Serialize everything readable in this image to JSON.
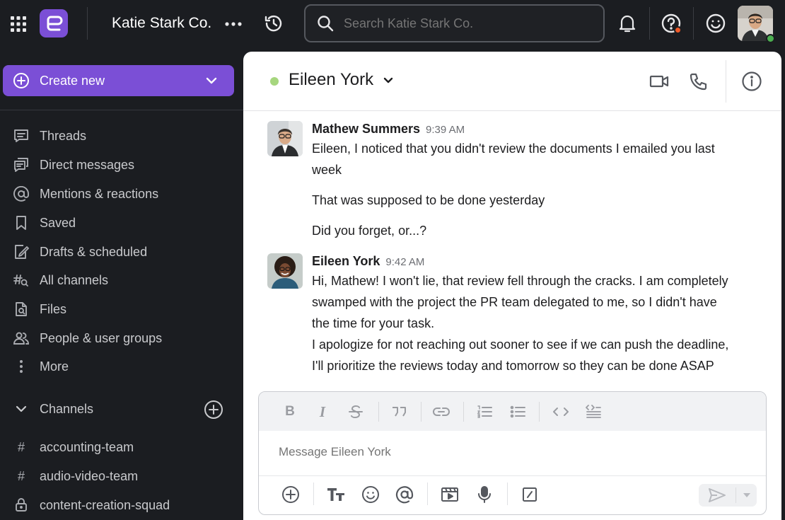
{
  "topbar": {
    "team_name": "Katie Stark Co.",
    "search_placeholder": "Search Katie Stark Co."
  },
  "sidebar": {
    "create_label": "Create new",
    "nav": [
      {
        "label": "Threads",
        "icon": "threads-icon"
      },
      {
        "label": "Direct messages",
        "icon": "direct-messages-icon"
      },
      {
        "label": "Mentions & reactions",
        "icon": "at-icon"
      },
      {
        "label": "Saved",
        "icon": "bookmark-icon"
      },
      {
        "label": "Drafts & scheduled",
        "icon": "draft-icon"
      },
      {
        "label": "All channels",
        "icon": "channel-search-icon"
      },
      {
        "label": "Files",
        "icon": "file-search-icon"
      },
      {
        "label": "People & user groups",
        "icon": "people-icon"
      },
      {
        "label": "More",
        "icon": "more-vertical-icon"
      }
    ],
    "channels_label": "Channels",
    "channels": [
      {
        "name": "accounting-team",
        "icon": "hash-icon"
      },
      {
        "name": "audio-video-team",
        "icon": "hash-icon"
      },
      {
        "name": "content-creation-squad",
        "icon": "lock-icon"
      }
    ]
  },
  "conversation": {
    "title": "Eileen York",
    "status_color": "#a6d67e",
    "messages": [
      {
        "author": "Mathew Summers",
        "time": "9:39 AM",
        "lines": [
          "Eileen, I noticed that you didn't review the documents I emailed you last",
          "week",
          "That was supposed to be done yesterday",
          "Did you forget, or...?"
        ]
      },
      {
        "author": "Eileen York",
        "time": "9:42 AM",
        "lines": [
          "Hi, Mathew! I won't lie, that review fell through the cracks. I am completely",
          "swamped with the project the PR team delegated to me, so I didn't have",
          "the time for your task.",
          "I apologize for not reaching out sooner to see if we can push the deadline,",
          "I'll prioritize the reviews today and tomorrow so they can be done ASAP"
        ]
      }
    ]
  },
  "composer": {
    "placeholder": "Message Eileen York",
    "formatting_icons": [
      "bold-icon",
      "italic-icon",
      "strikethrough-icon",
      "quote-icon",
      "link-icon",
      "numbered-list-icon",
      "bulleted-list-icon",
      "code-icon",
      "code-block-icon"
    ],
    "action_icons": [
      "attach-plus-icon",
      "text-format-icon",
      "emoji-icon",
      "mention-icon",
      "gif-icon",
      "microphone-icon",
      "slash-command-icon",
      "send-icon",
      "chevron-down-icon"
    ]
  },
  "colors": {
    "accent": "#7b4fd6",
    "background_dark": "#1b1d21",
    "notification_dot": "#f05a28",
    "online": "#4caf50"
  }
}
